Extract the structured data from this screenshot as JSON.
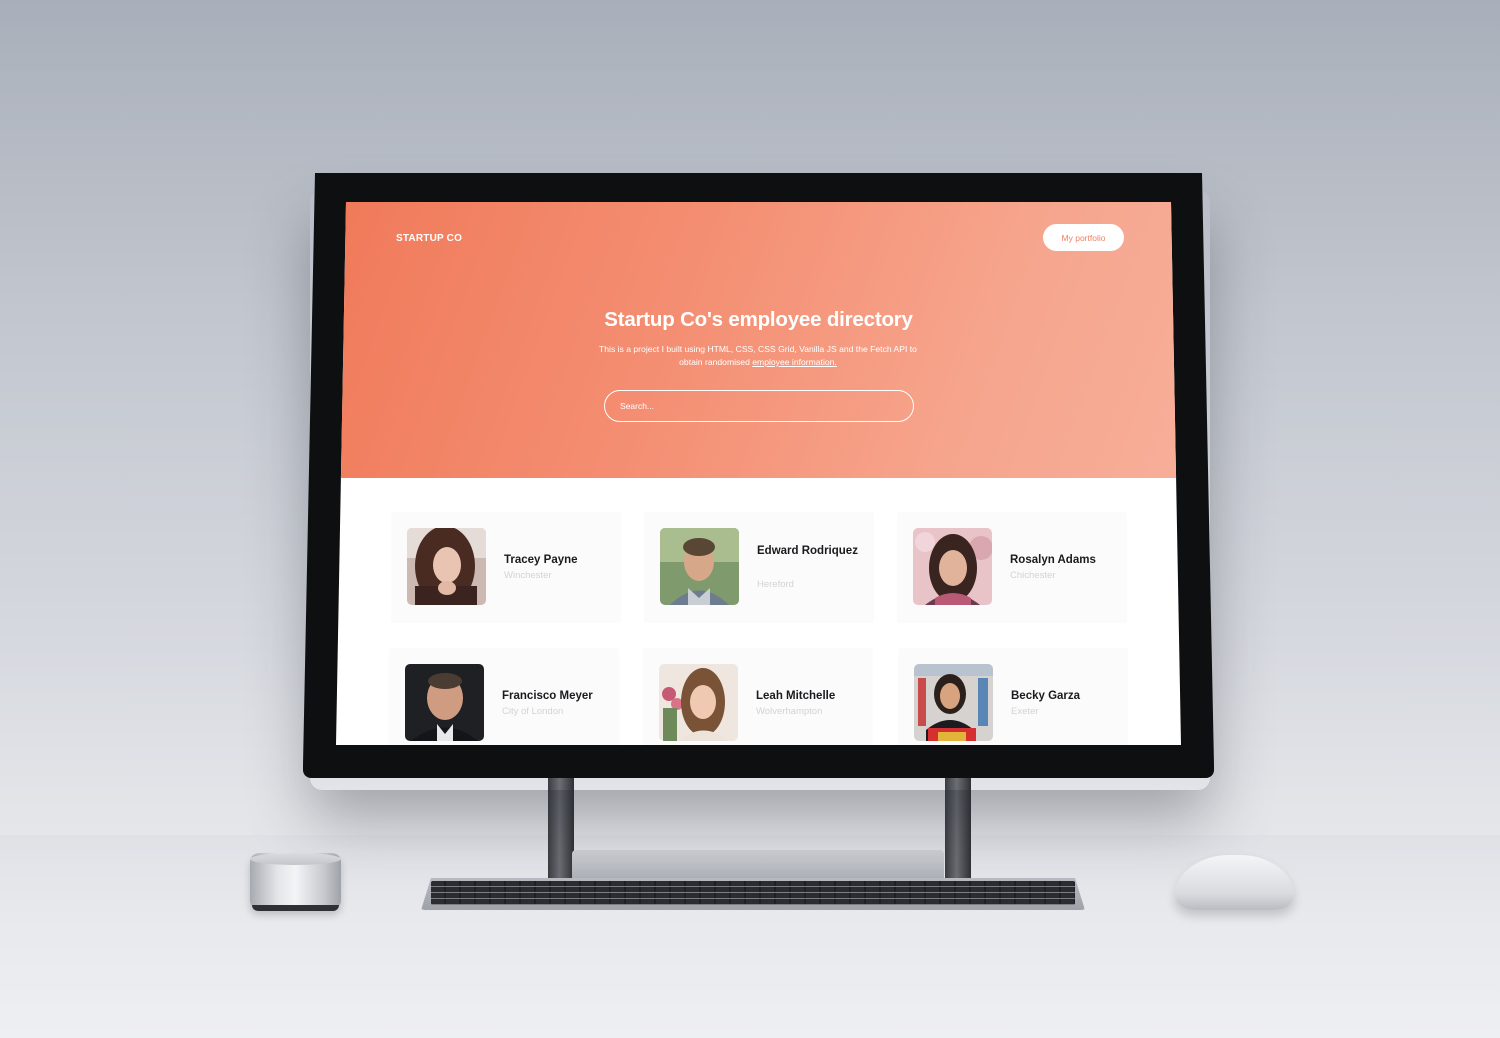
{
  "header": {
    "brand": "STARTUP CO",
    "portfolio_button": "My portfolio"
  },
  "hero": {
    "title": "Startup Co's employee directory",
    "description_prefix": "This is a project I built using HTML, CSS, CSS Grid, Vanilla JS and the Fetch API to obtain randomised",
    "description_link": "employee information."
  },
  "search": {
    "placeholder": "Search..."
  },
  "employees": [
    {
      "name": "Tracey Payne",
      "city": "Winchester"
    },
    {
      "name": "Edward Rodriquez",
      "city": "Hereford"
    },
    {
      "name": "Rosalyn Adams",
      "city": "Chichester"
    },
    {
      "name": "Francisco Meyer",
      "city": "City of London"
    },
    {
      "name": "Leah Mitchelle",
      "city": "Wolverhampton"
    },
    {
      "name": "Becky Garza",
      "city": "Exeter"
    }
  ],
  "colors": {
    "accent": "#f27f60",
    "hero_gradient_start": "#f07a5a",
    "hero_gradient_end": "#f7ae99",
    "card_background": "#fbfbfb",
    "city_text": "#d3d3d6"
  }
}
